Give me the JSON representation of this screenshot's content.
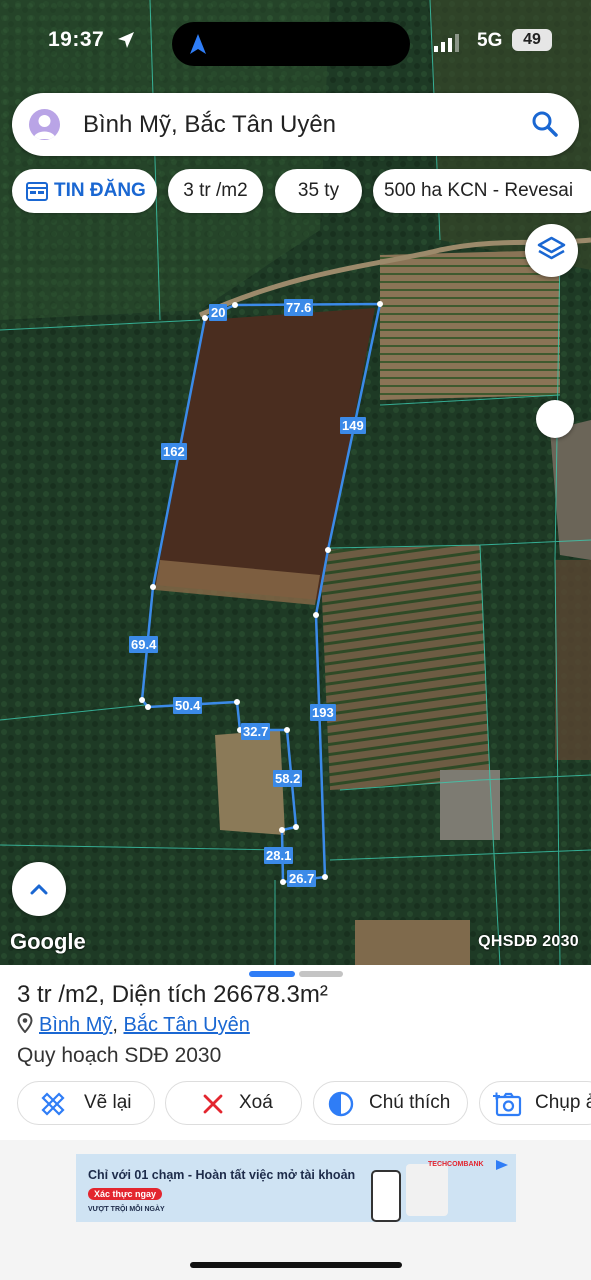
{
  "status_bar": {
    "time": "19:37",
    "network": "5G",
    "battery": "49"
  },
  "search": {
    "text": "Bình Mỹ, Bắc Tân Uyên"
  },
  "chips": [
    {
      "label": "TIN ĐĂNG",
      "icon": "calendar-icon"
    },
    {
      "label": "3 tr /m2"
    },
    {
      "label": "35 ty"
    },
    {
      "label": "500 ha KCN - Revesai"
    }
  ],
  "map": {
    "attribution": "Google",
    "layer_label": "QHSDĐ 2030",
    "segment_labels": [
      "20",
      "77.6",
      "149",
      "162",
      "69.4",
      "50.4",
      "32.7",
      "193",
      "58.2",
      "28.1",
      "26.7"
    ]
  },
  "sheet": {
    "price_prefix": "3 tr /m2, Diện tích ",
    "area": "26678.3m²",
    "address_part1": "Bình Mỹ",
    "address_sep": ", ",
    "address_part2": "Bắc Tân Uyên",
    "plan": "Quy hoạch SDĐ 2030",
    "actions": [
      "Vẽ lại",
      "Xoá",
      "Chú thích",
      "Chụp ả"
    ]
  },
  "ad": {
    "headline": "Chỉ với 01 chạm - Hoàn tất việc mở tài khoản",
    "cta": "Xác thực ngay",
    "tagline": "VƯỢT TRỘI MỖI NGÀY",
    "brand": "TECHCOMBANK"
  },
  "colors": {
    "accent": "#1a67d2",
    "polygon": "#3b8ae8",
    "ad_bg": "#cfe3f3",
    "cta": "#e3262f"
  }
}
